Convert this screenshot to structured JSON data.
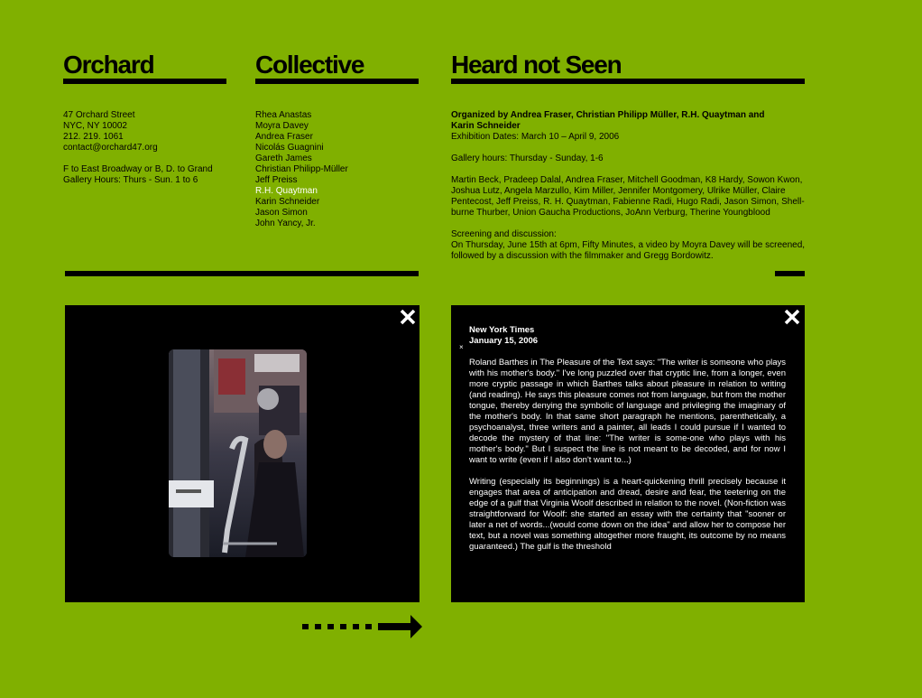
{
  "header": {
    "col1": "Orchard",
    "col2": "Collective",
    "col3": "Heard not Seen"
  },
  "contact": {
    "line1": "47 Orchard Street",
    "line2": "NYC, NY 10002",
    "line3": "212. 219. 1061",
    "email": "contact@orchard47.org",
    "directions": "F to East Broadway or B, D. to Grand",
    "hours": "Gallery Hours: Thurs - Sun. 1 to 6"
  },
  "collective": {
    "members": [
      "Rhea Anastas",
      "Moyra Davey",
      "Andrea Fraser",
      "Nicolás Guagnini",
      "Gareth James",
      "Christian Philipp-Müller",
      "Jeff Preiss",
      "R.H. Quaytman",
      "Karin Schneider",
      "Jason Simon",
      "John Yancy, Jr."
    ],
    "active": "R.H. Quaytman"
  },
  "exhibition": {
    "organizers_line1": "Organized by Andrea Fraser, Christian Philipp Müller, R.H. Quaytman and",
    "organizers_line2": "Karin Schneider",
    "dates": "Exhibition Dates: March 10 – April 9, 2006",
    "hours": "Gallery hours: Thursday - Sunday, 1-6",
    "artists": [
      "Martin Beck, Pradeep Dalal, Andrea Fraser, Mitchell Goodman, K8 Hardy, Sowon Kwon,",
      "Joshua Lutz, Angela Marzullo, Kim Miller, Jennifer Montgomery, Ulrike Müller, Claire",
      "Pentecost, Jeff Preiss, R. H. Quaytman, Fabienne Radi, Hugo Radi, Jason Simon, Shell-",
      "burne Thurber, Union Gaucha Productions, JoAnn Verburg, Therine Youngblood"
    ],
    "screening_title": "Screening and discussion:",
    "screening_line1": "On Thursday, June 15th at 6pm, Fifty Minutes, a video by Moyra Davey will be screened,",
    "screening_line2": "followed by a discussion with the filmmaker and Gregg Bordowitz."
  },
  "article": {
    "source": "New York Times",
    "date": "January 15, 2006",
    "para1": "Roland Barthes in The Pleasure of the Text says: \"The writer is someone who plays with his mother's body.\" I've long puzzled over that cryptic line, from a longer, even more cryptic passage in which Barthes talks about pleasure in relation to writing (and reading). He says this pleasure comes not from language, but from the mother tongue, thereby denying the symbolic of language and privileging the imaginary of the mother's body. In that same short paragraph he mentions, parenthetically, a psychoanalyst, three writers and a painter, all leads I could pursue if I wanted to decode the mystery of that line: \"The writer is some-one who plays with his mother's body.\" But I suspect the line is not meant to be decoded, and for now I want to write (even if I also don't want to...)",
    "para2": "Writing (especially its beginnings) is a heart-quickening thrill precisely because it engages that area of anticipation and dread, desire and fear, the teetering on the edge of a gulf that Virginia Woolf described in relation to the novel. (Non-fiction was straightforward for Woolf: she started an essay with the certainty that \"sooner or later a net of words...(would come down on the idea\" and allow her to compose her text, but a novel was something altogether more fraught, its outcome by no means guaranteed.) The gulf is the threshold",
    "mark": "×"
  },
  "icons": {
    "close": "close-icon",
    "next": "next-arrow-icon"
  },
  "colors": {
    "background": "#80b000",
    "panel": "#000000",
    "active_link": "#ffffff"
  }
}
